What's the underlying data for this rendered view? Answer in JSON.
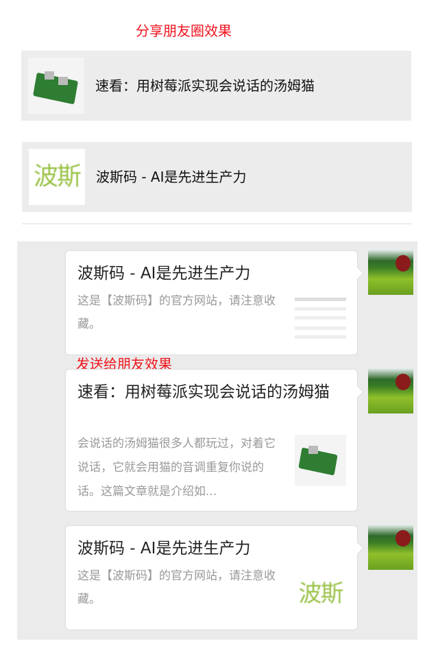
{
  "labels": {
    "moments": "分享朋友圈效果",
    "friend": "发送给朋友效果"
  },
  "share_rows": [
    {
      "title": "速看：用树莓派实现会说话的汤姆猫",
      "thumb": "raspberry-pi-image"
    },
    {
      "title": "波斯码 - AI是先进生产力",
      "thumb_text": "波斯"
    }
  ],
  "messages": [
    {
      "title": "波斯码 - AI是先进生产力",
      "desc": "这是【波斯码】的官方网站，请注意收藏。",
      "thumb": "website-screenshot"
    },
    {
      "title": "速看：用树莓派实现会说话的汤姆猫",
      "desc": "会说话的汤姆猫很多人都玩过，对着它说话，它就会用猫的音调重复你说的话。这篇文章就是介绍如...",
      "thumb": "raspberry-pi-image"
    },
    {
      "title": "波斯码 - AI是先进生产力",
      "desc": "这是【波斯码】的官方网站，请注意收藏。",
      "thumb_text": "波斯"
    }
  ],
  "colors": {
    "label": "#f0141e",
    "bg": "#ebebeb"
  }
}
